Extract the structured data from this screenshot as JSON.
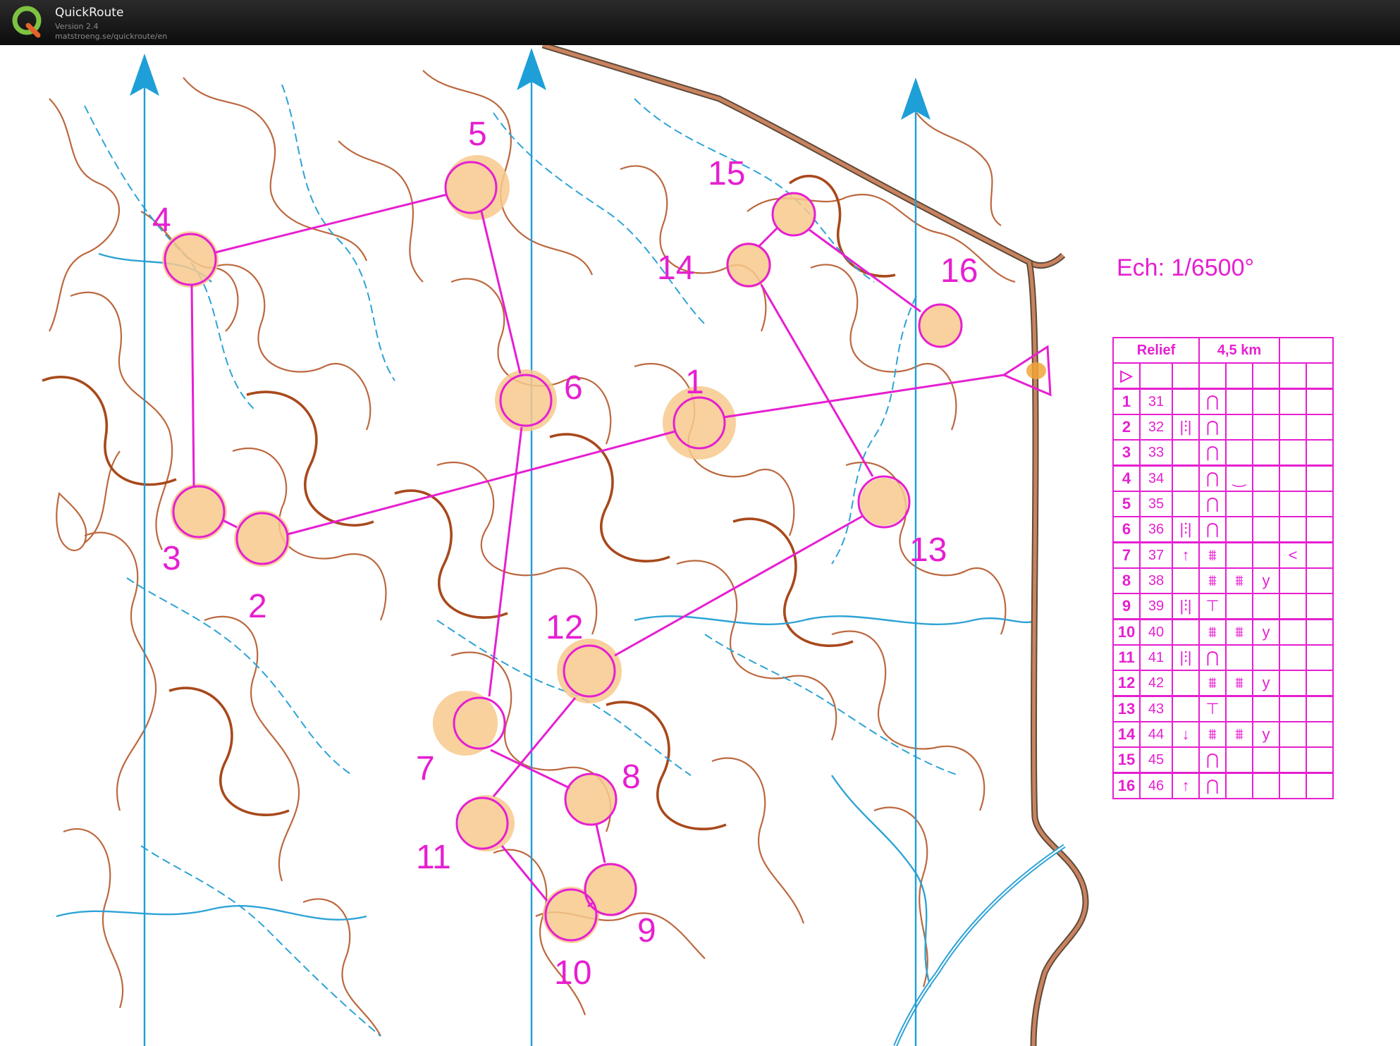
{
  "app": {
    "title": "QuickRoute",
    "version": "Version 2.4",
    "url": "matstroeng.se/quickroute/en"
  },
  "colors": {
    "overprint": "#e61fd1",
    "contour": "#b5582a",
    "water": "#2ea3d6",
    "north_line": "#1e9fd8",
    "control_fill": "#f7c98d",
    "road": "#5e4a3a"
  },
  "map": {
    "scale_label": "Ech: 1/6500°",
    "controls": [
      {
        "label": "1"
      },
      {
        "label": "2"
      },
      {
        "label": "3"
      },
      {
        "label": "4"
      },
      {
        "label": "5"
      },
      {
        "label": "6"
      },
      {
        "label": "7"
      },
      {
        "label": "8"
      },
      {
        "label": "9"
      },
      {
        "label": "10"
      },
      {
        "label": "11"
      },
      {
        "label": "12"
      },
      {
        "label": "13"
      },
      {
        "label": "14"
      },
      {
        "label": "15"
      },
      {
        "label": "16"
      }
    ],
    "north_arrows": [
      "north-arrow-1",
      "north-arrow-2",
      "north-arrow-3"
    ]
  },
  "legend": {
    "header_left": "Relief",
    "header_right": "4,5 km",
    "start_symbol": "▷",
    "rows": [
      {
        "num": "1",
        "code": "31",
        "c": "",
        "d": "⋂",
        "e": "",
        "f": "",
        "g": ""
      },
      {
        "num": "2",
        "code": "32",
        "c": "|⫶|",
        "d": "⋂",
        "e": "",
        "f": "",
        "g": ""
      },
      {
        "num": "3",
        "code": "33",
        "c": "",
        "d": "⋂",
        "e": "",
        "f": "",
        "g": ""
      },
      {
        "num": "4",
        "code": "34",
        "c": "",
        "d": "⋂",
        "e": "‿",
        "f": "",
        "g": ""
      },
      {
        "num": "5",
        "code": "35",
        "c": "",
        "d": "⋂",
        "e": "",
        "f": "",
        "g": ""
      },
      {
        "num": "6",
        "code": "36",
        "c": "|⫶|",
        "d": "⋂",
        "e": "",
        "f": "",
        "g": ""
      },
      {
        "num": "7",
        "code": "37",
        "c": "↑",
        "d": "⩩",
        "e": "",
        "f": "",
        "g": "<"
      },
      {
        "num": "8",
        "code": "38",
        "c": "",
        "d": "⩩",
        "e": "⩩",
        "f": "y",
        "g": ""
      },
      {
        "num": "9",
        "code": "39",
        "c": "|⫶|",
        "d": "⊤",
        "e": "",
        "f": "",
        "g": ""
      },
      {
        "num": "10",
        "code": "40",
        "c": "",
        "d": "⩩",
        "e": "⩩",
        "f": "y",
        "g": ""
      },
      {
        "num": "11",
        "code": "41",
        "c": "|⫶|",
        "d": "⋂",
        "e": "",
        "f": "",
        "g": ""
      },
      {
        "num": "12",
        "code": "42",
        "c": "",
        "d": "⩩",
        "e": "⩩",
        "f": "y",
        "g": ""
      },
      {
        "num": "13",
        "code": "43",
        "c": "",
        "d": "⊤",
        "e": "",
        "f": "",
        "g": ""
      },
      {
        "num": "14",
        "code": "44",
        "c": "↓",
        "d": "⩩",
        "e": "⩩",
        "f": "y",
        "g": ""
      },
      {
        "num": "15",
        "code": "45",
        "c": "",
        "d": "⋂",
        "e": "",
        "f": "",
        "g": ""
      },
      {
        "num": "16",
        "code": "46",
        "c": "↑",
        "d": "⋂",
        "e": "",
        "f": "",
        "g": ""
      }
    ]
  }
}
